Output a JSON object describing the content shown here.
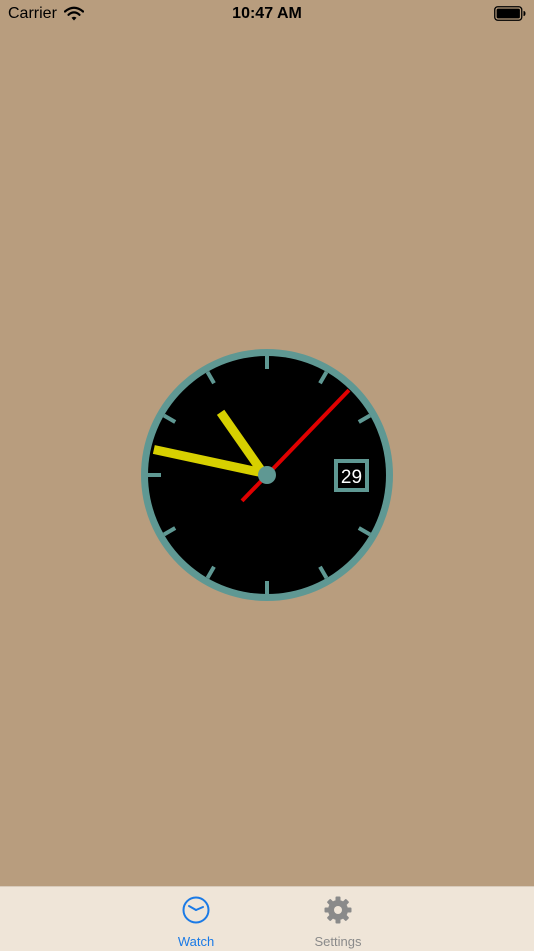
{
  "status_bar": {
    "carrier": "Carrier",
    "time": "10:47 AM"
  },
  "watch": {
    "date": "29",
    "time_shown": "10:47",
    "second_hand_seconds": 7,
    "colors": {
      "background": "#b89d7e",
      "bezel": "#5f9893",
      "face": "#000000",
      "hour_minute_hands": "#d7d000",
      "second_hand": "#e00000",
      "date_box": "#5f9893",
      "date_text": "#ffffff"
    }
  },
  "tab_bar": {
    "tabs": [
      {
        "label": "Watch",
        "icon": "clock-icon",
        "selected": true,
        "color": "#1a7ae6"
      },
      {
        "label": "Settings",
        "icon": "gear-icon",
        "selected": false,
        "color": "#8a8a8a"
      }
    ]
  }
}
